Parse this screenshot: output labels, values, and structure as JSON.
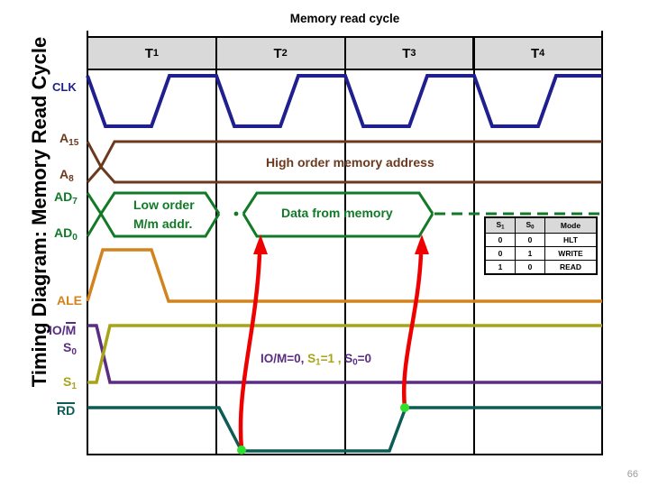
{
  "page": {
    "side_title": "Timing Diagram: Memory Read Cycle",
    "page_number": "66"
  },
  "cycle": {
    "label": "Memory read cycle"
  },
  "tstates": [
    {
      "name": "T",
      "sub": "1"
    },
    {
      "name": "T",
      "sub": "2"
    },
    {
      "name": "T",
      "sub": "3"
    },
    {
      "name": "T",
      "sub": "4"
    }
  ],
  "signals": [
    {
      "id": "clk",
      "label": "CLK",
      "sub": "",
      "overline": false,
      "color": "#1f1f8f"
    },
    {
      "id": "a15",
      "label": "A",
      "sub": "15",
      "overline": false,
      "color": "#6b3a1e"
    },
    {
      "id": "a8",
      "label": "A",
      "sub": "8",
      "overline": false,
      "color": "#6b3a1e"
    },
    {
      "id": "ad7",
      "label": "AD",
      "sub": "7",
      "overline": false,
      "color": "#127a27"
    },
    {
      "id": "ad0",
      "label": "AD",
      "sub": "0",
      "overline": false,
      "color": "#127a27"
    },
    {
      "id": "ale",
      "label": "ALE",
      "sub": "",
      "overline": false,
      "color": "#d2831c"
    },
    {
      "id": "iom",
      "label": "IO/M",
      "sub": "",
      "overline": true,
      "color": "#5b2d82"
    },
    {
      "id": "s0",
      "label": "S",
      "sub": "0",
      "overline": false,
      "color": "#5b2d82"
    },
    {
      "id": "s1",
      "label": "S",
      "sub": "1",
      "overline": false,
      "color": "#a8a319"
    },
    {
      "id": "rd",
      "label": "RD",
      "sub": "",
      "overline": true,
      "color": "#0d5b55"
    }
  ],
  "bus_labels": {
    "high_address": "High order memory address",
    "low_address_line1": "Low order",
    "low_address_line2": "M/m addr.",
    "data": "Data from memory"
  },
  "annotation": {
    "part1": "IO/M=0,",
    "part2_base": "S",
    "part2_sub": "1",
    "part2_tail": "=1 ,",
    "part3_base": "S",
    "part3_sub": "0",
    "part3_tail": "=0"
  },
  "mode_table": {
    "headers": [
      {
        "base": "S",
        "sub": "1"
      },
      {
        "base": "S",
        "sub": "0"
      },
      {
        "base": "Mode",
        "sub": ""
      }
    ],
    "rows": [
      {
        "s1": "0",
        "s0": "0",
        "mode": "HLT"
      },
      {
        "s1": "0",
        "s0": "1",
        "mode": "WRITE"
      },
      {
        "s1": "1",
        "s0": "0",
        "mode": "READ"
      }
    ]
  },
  "colors": {
    "clk": "#1f1f8f",
    "address": "#6b3a1e",
    "data_bus": "#127a27",
    "ale": "#d2831c",
    "s0": "#5b2d82",
    "s1": "#a8a319",
    "rd": "#0d5b55",
    "arrow": "#ee0000",
    "dot": "#2fe02f",
    "header_bg": "#d9d9d9",
    "frame": "#000000"
  }
}
